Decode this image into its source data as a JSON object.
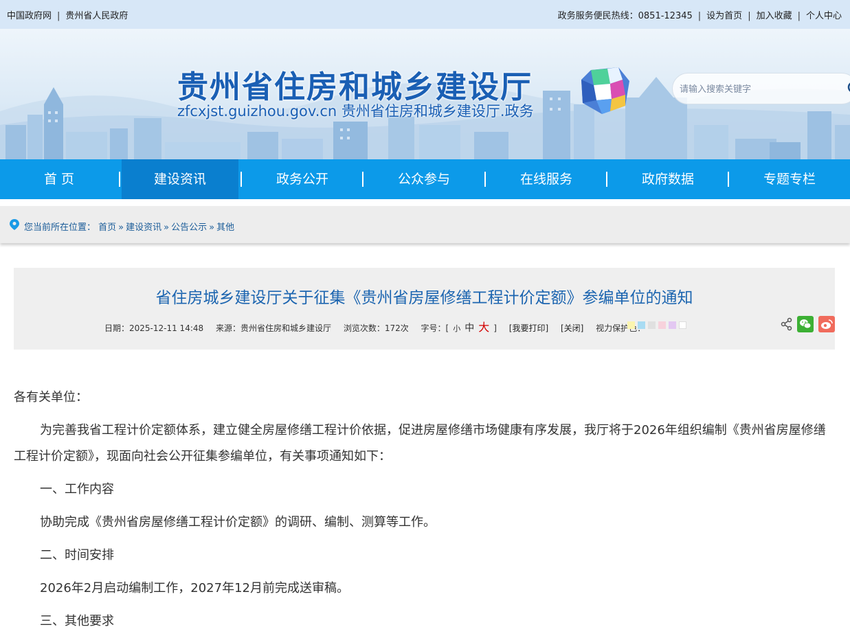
{
  "topbar": {
    "left_links": [
      "中国政府网",
      "贵州省人民政府"
    ],
    "hotline_label": "政务服务便民热线：",
    "hotline_number": "0851-12345",
    "right_links": [
      "设为首页",
      "加入收藏",
      "个人中心"
    ]
  },
  "banner": {
    "title": "贵州省住房和城乡建设厅",
    "subtitle": "zfcxjst.guizhou.gov.cn 贵州省住房和城乡建设厅.政务",
    "search_placeholder": "请输入搜索关键字"
  },
  "nav": {
    "items": [
      "首  页",
      "建设资讯",
      "政务公开",
      "公众参与",
      "在线服务",
      "政府数据",
      "专题专栏"
    ],
    "active_index": 1,
    "color": "#0c9ae9",
    "active_color": "#0a7fcf"
  },
  "breadcrumb": {
    "prefix": "您当前所在位置：",
    "items": [
      "首页",
      "建设资讯",
      "公告公示",
      "其他"
    ],
    "separator": "»"
  },
  "article": {
    "title": "省住房城乡建设厅关于征集《贵州省房屋修缮工程计价定额》参编单位的通知",
    "date": "日期：2025-12-11 14:48",
    "source": "来源：贵州省住房和城乡建设厅",
    "views": "浏览次数：172次",
    "font_size_label": "字号：[",
    "font_small": "小",
    "font_mid": "中",
    "font_big": "大",
    "font_close": "]",
    "print_link": "[我要打印]",
    "close_link": "[关闭]",
    "eye_protect_label": "视力保护色：",
    "eye_colors": [
      "#fbf5b0",
      "#a9dcf3",
      "#e0e0e0",
      "#f7d2dc",
      "#e3c8f2",
      "#ffffff"
    ],
    "share_icons": [
      "share-icon",
      "wechat-icon",
      "weibo-icon"
    ]
  },
  "content": {
    "paragraphs": [
      "各有关单位：",
      "为完善我省工程计价定额体系，建立健全房屋修缮工程计价依据，促进房屋修缮市场健康有序发展，我厅将于2026年组织编制《贵州省房屋修缮工程计价定额》，现面向社会公开征集参编单位，有关事项通知如下：",
      "一、工作内容",
      "协助完成《贵州省房屋修缮工程计价定额》的调研、编制、测算等工作。",
      "二、时间安排",
      "2026年2月启动编制工作，2027年12月前完成送审稿。",
      "三、其他要求"
    ]
  }
}
